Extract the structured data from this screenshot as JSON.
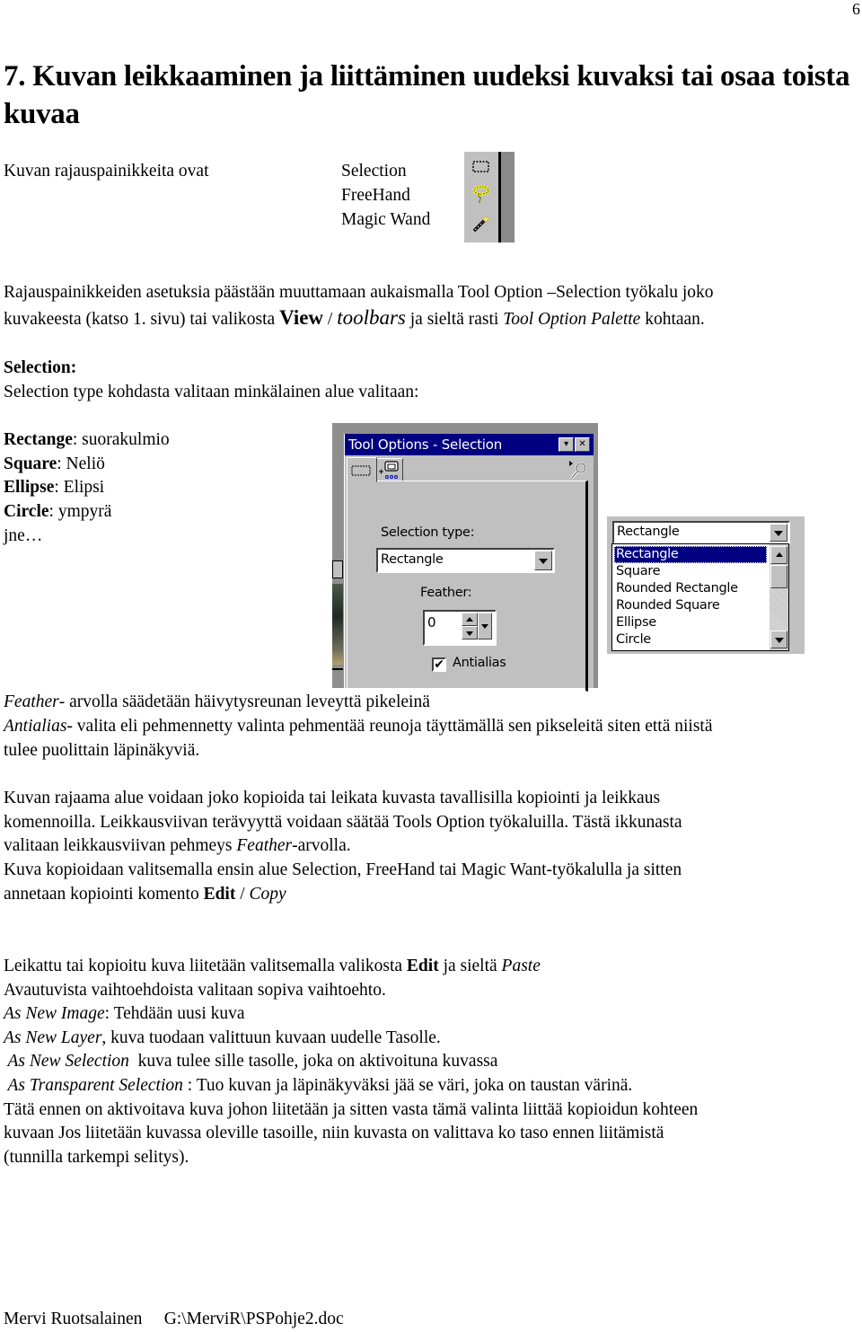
{
  "page": {
    "number": "6",
    "title": "7. Kuvan leikkaaminen ja liittäminen uudeksi kuvaksi tai osaa toista kuvaa"
  },
  "intro": {
    "lead": "Kuvan rajauspainikkeita ovat",
    "tools": [
      "Selection",
      "FreeHand",
      "Magic Wand"
    ],
    "tool_icons": [
      "selection-rectangle-icon",
      "freehand-lasso-icon",
      "magic-wand-icon"
    ]
  },
  "options_paragraph": {
    "line1": "Rajauspainikkeiden asetuksia päästään muuttamaan aukaismalla Tool Option –Selection työkalu joko",
    "line2_a": "kuvakeesta (katso 1. sivu) tai valikosta ",
    "view": "View",
    "slash": " / ",
    "toolbars": "toolbars",
    "line2_b": "  ja sieltä rasti ",
    "palette": "Tool Option Palette",
    "line2_c": " kohtaan."
  },
  "selection_section": {
    "heading": "Selection:",
    "desc": "Selection type kohdasta valitaan minkälainen alue valitaan:",
    "types": [
      {
        "term": "Rectange",
        "meaning": ": suorakulmio"
      },
      {
        "term": "Square",
        "meaning": ": Neliö"
      },
      {
        "term": "Ellipse",
        "meaning": ": Elipsi"
      },
      {
        "term": "Circle",
        "meaning": ": ympyrä"
      }
    ],
    "etc": "jne…"
  },
  "dialog": {
    "title": "Tool Options - Selection",
    "minimize_glyph": "▾",
    "close_glyph": "✕",
    "selection_type_label": "Selection type:",
    "selection_type_value": "Rectangle",
    "feather_label": "Feather:",
    "feather_value": "0",
    "antialias_label": "Antialias",
    "antialias_checked": true,
    "check_glyph": "✔"
  },
  "dropdown": {
    "current": "Rectangle",
    "options": [
      "Rectangle",
      "Square",
      "Rounded Rectangle",
      "Rounded Square",
      "Ellipse",
      "Circle"
    ],
    "selected_index": 0
  },
  "notes": {
    "feather_term": "Feather",
    "feather_text": "- arvolla säädetään häivytysreunan leveyttä pikeleinä",
    "antialias_term": "Antialias",
    "antialias_text1": "- valita eli pehmennetty valinta  pehmentää reunoja täyttämällä sen pikseleitä siten että niistä",
    "antialias_text2": "tulee puolittain läpinäkyviä."
  },
  "copy_paragraph": {
    "line1": "Kuvan rajaama alue voidaan joko kopioida tai leikata kuvasta tavallisilla kopiointi ja leikkaus",
    "line2": "komennoilla.  Leikkausviivan terävyyttä voidaan säätää Tools Option työkaluilla. Tästä ikkunasta",
    "line3_a": "valitaan leikkausviivan pehmeys ",
    "line3_term": "Feather",
    "line3_b": "-arvolla.",
    "line4": "Kuva kopioidaan valitsemalla ensin alue Selection, FreeHand tai Magic Want-työkalulla ja sitten",
    "line5_a": "annetaan kopiointi komento ",
    "edit": "Edit",
    "slash": " / ",
    "copy": "Copy"
  },
  "paste_paragraph": {
    "line1_a": "Leikattu tai kopioitu kuva liitetään valitsemalla valikosta ",
    "edit": "Edit",
    "line1_b": " ja sieltä ",
    "paste": "Paste",
    "line2": "Avautuvista vaihtoehdoista valitaan sopiva vaihtoehto.",
    "options": [
      {
        "term": "As New Image",
        "text": ": Tehdään uusi kuva"
      },
      {
        "term": "As New Layer",
        "text": ",  kuva tuodaan valittuun kuvaan uudelle Tasolle."
      },
      {
        "term": " As New Selection",
        "text": "  kuva tulee sille tasolle, joka on aktivoituna kuvassa"
      },
      {
        "term": " As Transparent Selection",
        "text": " : Tuo kuvan ja läpinäkyväksi jää se väri, joka on taustan värinä."
      }
    ],
    "line7": "Tätä ennen on aktivoitava kuva johon liitetään ja sitten vasta tämä valinta liittää kopioidun kohteen",
    "line8": "kuvaan Jos liitetään kuvassa oleville tasoille, niin kuvasta on valittava ko taso ennen liitämistä",
    "line9": "(tunnilla tarkempi selitys)."
  },
  "footer": {
    "author": "Mervi Ruotsalainen",
    "path": "G:\\MerviR\\PSPohje2.doc"
  }
}
